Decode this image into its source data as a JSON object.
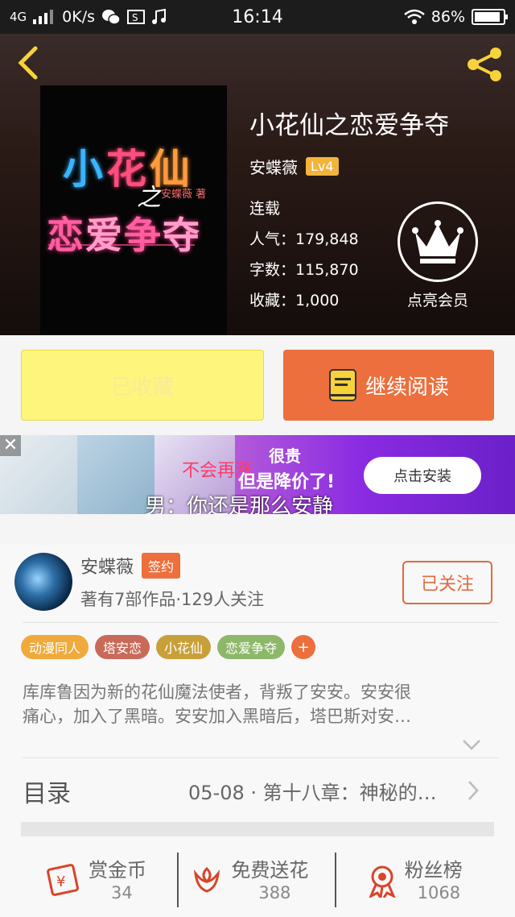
{
  "status_bar": {
    "network": "4G",
    "speed": "0K/s",
    "time": "16:14",
    "battery": "86%"
  },
  "book": {
    "title": "小花仙之恋爱争夺",
    "author": "安蝶薇",
    "level": "Lv4",
    "status": "连载",
    "popularity": "人气：179,848",
    "word_count": "字数：115,870",
    "favorites": "收藏：1,000"
  },
  "cover": {
    "line1": [
      "小",
      "花",
      "仙"
    ],
    "zhi": "之",
    "author": "安蝶薇 著",
    "line2": [
      "恋",
      "爱",
      "争",
      "夺"
    ]
  },
  "member": {
    "label": "点亮会员"
  },
  "buttons": {
    "collected": "已收藏",
    "continue_read": "继续阅读"
  },
  "ad": {
    "close": "✕",
    "text1": "不会再涨",
    "text2": "很贵",
    "text3": "但是降价了!",
    "overlay": "男：你还是那么安静",
    "install": "点击安装"
  },
  "author_card": {
    "name": "安蝶薇",
    "badge": "签约",
    "subtitle": "著有7部作品·129人关注",
    "follow": "已关注"
  },
  "tags": [
    {
      "label": "动漫同人",
      "color": "#f0a93b"
    },
    {
      "label": "塔安恋",
      "color": "#c86a5a"
    },
    {
      "label": "小花仙",
      "color": "#c8a03a"
    },
    {
      "label": "恋爱争夺",
      "color": "#8db86a"
    }
  ],
  "tag_more": "+",
  "description": {
    "line1": "库库鲁因为新的花仙魔法使者，背叛了安安。安安很",
    "line2": "痛心，加入了黑暗。安安加入黑暗后，塔巴斯对安…"
  },
  "toc": {
    "title": "目录",
    "latest": "05-08 · 第十八章：神秘的…"
  },
  "stats": [
    {
      "name": "赏金币",
      "value": "34"
    },
    {
      "name": "免费送花",
      "value": "388"
    },
    {
      "name": "粉丝榜",
      "value": "1068"
    }
  ]
}
